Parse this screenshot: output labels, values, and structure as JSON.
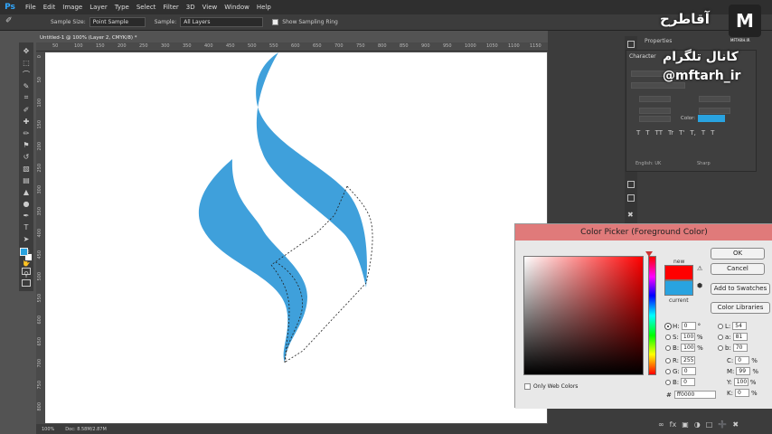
{
  "menu": {
    "logo": "Ps",
    "items": [
      "File",
      "Edit",
      "Image",
      "Layer",
      "Type",
      "Select",
      "Filter",
      "3D",
      "View",
      "Window",
      "Help"
    ]
  },
  "options_bar": {
    "sample_size_label": "Sample Size:",
    "sample_size_value": "Point Sample",
    "sample_label": "Sample:",
    "sample_value": "All Layers",
    "sampling_ring_label": "Show Sampling Ring"
  },
  "document": {
    "tab_title": "Untitled-1 @ 100% (Layer 2, CMYK/8) *",
    "zoom": "100%",
    "doc_info": "Doc: 8.58M/2.87M"
  },
  "ruler_top_ticks": [
    "50",
    "100",
    "150",
    "200",
    "250",
    "300",
    "350",
    "400",
    "450",
    "500",
    "550",
    "600",
    "650",
    "700",
    "750",
    "800",
    "850",
    "900",
    "950",
    "1000",
    "1050",
    "1100",
    "1150"
  ],
  "ruler_left_ticks": [
    "0",
    "50",
    "100",
    "150",
    "200",
    "250",
    "300",
    "350",
    "400",
    "450",
    "500",
    "550",
    "600",
    "650",
    "700",
    "750",
    "800"
  ],
  "panels": {
    "character_tab": "Character",
    "properties_tab": "Properties",
    "color_label": "Color:",
    "language": "English: UK",
    "antialias": "Sharp",
    "format_buttons": [
      "T",
      "T",
      "TT",
      "Tr",
      "T'",
      "T,",
      "T",
      "T"
    ]
  },
  "watermark": {
    "logo": "M",
    "line1": "آقاطرح",
    "line2": "کانال تلگرام",
    "line3": "@mftarh_ir",
    "small": "MFTARH.IR"
  },
  "color_picker": {
    "title": "Color Picker (Foreground Color)",
    "new_label": "new",
    "current_label": "current",
    "new_color": "#ff0000",
    "current_color": "#29a3e0",
    "ok": "OK",
    "cancel": "Cancel",
    "add_to_swatches": "Add to Swatches",
    "color_libraries": "Color Libraries",
    "hsb": [
      {
        "label": "H:",
        "value": "0",
        "unit": "°"
      },
      {
        "label": "S:",
        "value": "100",
        "unit": "%"
      },
      {
        "label": "B:",
        "value": "100",
        "unit": "%"
      }
    ],
    "rgb": [
      {
        "label": "R:",
        "value": "255"
      },
      {
        "label": "G:",
        "value": "0"
      },
      {
        "label": "B:",
        "value": "0"
      }
    ],
    "lab": [
      {
        "label": "L:",
        "value": "54"
      },
      {
        "label": "a:",
        "value": "81"
      },
      {
        "label": "b:",
        "value": "70"
      }
    ],
    "cmyk": [
      {
        "label": "C:",
        "value": "0",
        "unit": "%"
      },
      {
        "label": "M:",
        "value": "99",
        "unit": "%"
      },
      {
        "label": "Y:",
        "value": "100",
        "unit": "%"
      },
      {
        "label": "K:",
        "value": "0",
        "unit": "%"
      }
    ],
    "only_web_colors": "Only Web Colors",
    "hex_label": "#",
    "hex_value": "ff0000"
  },
  "colors": {
    "shape_blue": "#3fa0db",
    "foreground": "#29a3e0",
    "background": "#ffffff"
  }
}
